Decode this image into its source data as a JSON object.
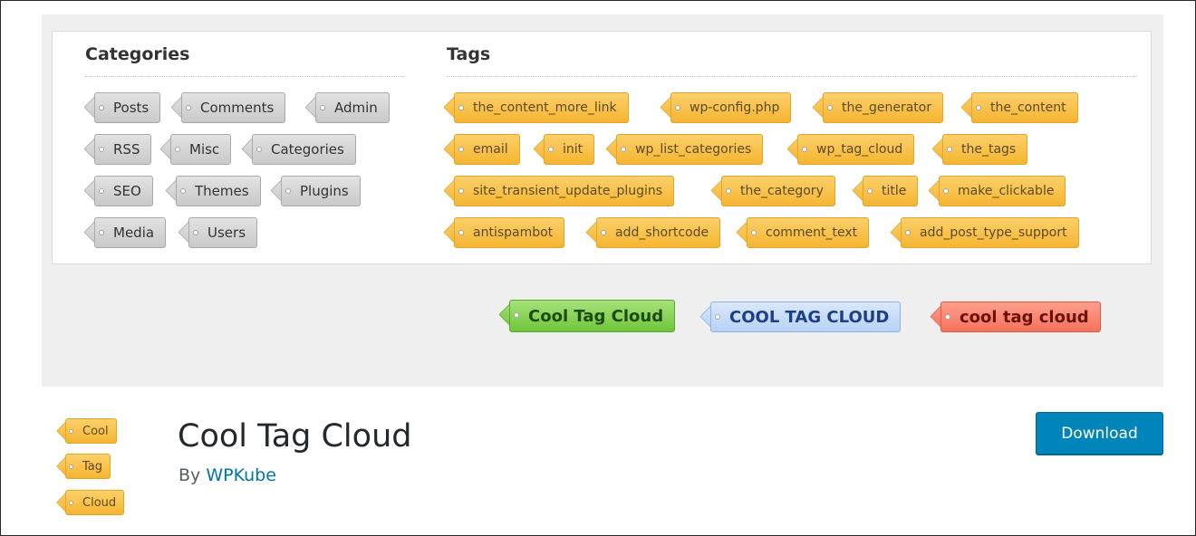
{
  "banner": {
    "categories_title": "Categories",
    "tags_title": "Tags",
    "categories": [
      "Posts",
      "Comments",
      "Admin",
      "RSS",
      "Misc",
      "Categories",
      "SEO",
      "Themes",
      "Plugins",
      "Media",
      "Users"
    ],
    "tags": [
      "the_content_more_link",
      "wp-config.php",
      "the_generator",
      "the_content",
      "email",
      "init",
      "wp_list_categories",
      "wp_tag_cloud",
      "the_tags",
      "site_transient_update_plugins",
      "the_category",
      "title",
      "make_clickable",
      "antispambot",
      "add_shortcode",
      "comment_text",
      "add_post_type_support"
    ],
    "styles": [
      {
        "label": "Cool Tag Cloud",
        "color": "green"
      },
      {
        "label": "COOL TAG CLOUD",
        "color": "blue"
      },
      {
        "label": "cool tag cloud",
        "color": "red"
      }
    ]
  },
  "plugin": {
    "icon_tags": [
      "Cool",
      "Tag",
      "Cloud"
    ],
    "title": "Cool Tag Cloud",
    "by_prefix": "By",
    "author": "WPKube",
    "download_label": "Download"
  },
  "colors": {
    "download_bg": "#0085ba",
    "author_link": "#0073aa",
    "gold_tag": "#f5b531",
    "gray_tag": "#c9c9c9",
    "green_tag": "#6fc63c",
    "blue_tag": "#b7d2f5",
    "red_tag": "#f6725c"
  }
}
